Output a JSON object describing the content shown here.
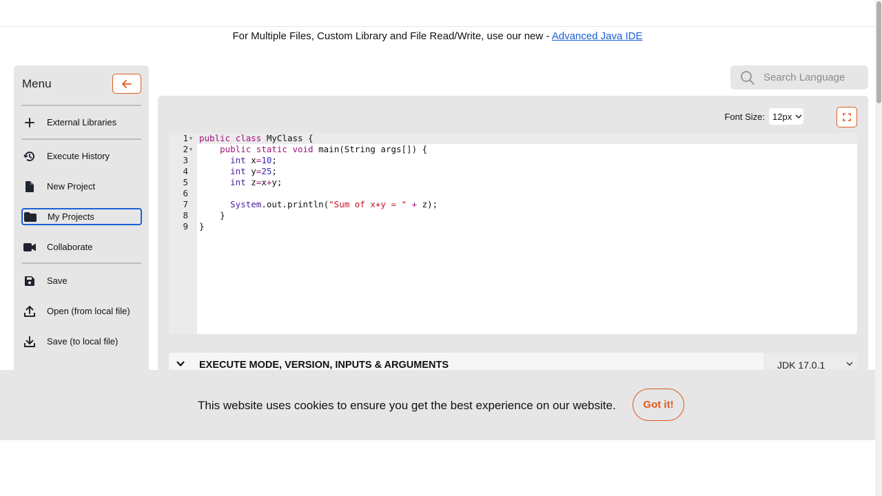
{
  "promo": {
    "text": "For Multiple Files, Custom Library and File Read/Write, use our new - ",
    "link": "Advanced Java IDE"
  },
  "menu": {
    "title": "Menu",
    "items": [
      {
        "label": "External Libraries",
        "icon": "plus-icon"
      },
      {
        "label": "Execute History",
        "icon": "history-icon"
      },
      {
        "label": "New Project",
        "icon": "file-icon"
      },
      {
        "label": "My Projects",
        "icon": "folder-icon"
      },
      {
        "label": "Collaborate",
        "icon": "video-icon"
      },
      {
        "label": "Save",
        "icon": "floppy-icon"
      },
      {
        "label": "Open (from local file)",
        "icon": "upload-icon"
      },
      {
        "label": "Save (to local file)",
        "icon": "download-icon"
      }
    ]
  },
  "search": {
    "placeholder": "Search Language"
  },
  "editor": {
    "font_size_label": "Font Size:",
    "font_size_value": "12px",
    "line_numbers": [
      "1",
      "2",
      "3",
      "4",
      "5",
      "6",
      "7",
      "8",
      "9"
    ]
  },
  "exec": {
    "label": "EXECUTE MODE, VERSION, INPUTS & ARGUMENTS",
    "jdk": "JDK 17.0.1"
  },
  "cookie": {
    "message": "This website uses cookies to ensure you get the best experience on our website.",
    "button": "Got it!"
  },
  "colors": {
    "accent": "#e05a1b",
    "link": "#1a5fd6",
    "panel": "#e6e6e6"
  }
}
